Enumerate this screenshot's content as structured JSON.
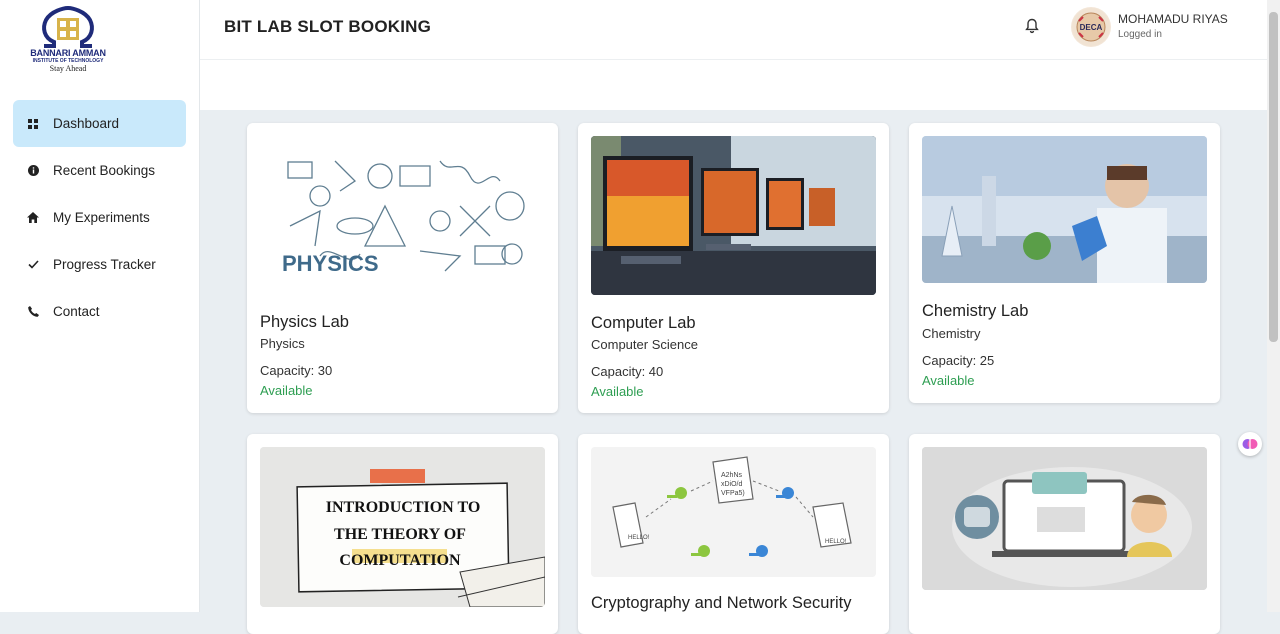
{
  "sidebar": {
    "logo": {
      "name": "BANNARI AMMAN",
      "subtitle": "INSTITUTE OF TECHNOLOGY",
      "tagline": "Stay Ahead"
    },
    "items": [
      {
        "label": "Dashboard",
        "icon": "grid-icon",
        "active": true
      },
      {
        "label": "Recent Bookings",
        "icon": "info-icon",
        "active": false
      },
      {
        "label": "My Experiments",
        "icon": "home-icon",
        "active": false
      },
      {
        "label": "Progress Tracker",
        "icon": "check-icon",
        "active": false
      },
      {
        "label": "Contact",
        "icon": "phone-icon",
        "active": false
      }
    ]
  },
  "header": {
    "title": "BIT LAB SLOT BOOKING",
    "user": {
      "name": "MOHAMADU RIYAS",
      "status": "Logged in",
      "avatar_text": "DECA"
    }
  },
  "labs": [
    {
      "title": "Physics Lab",
      "department": "Physics",
      "capacity": "Capacity: 30",
      "status": "Available",
      "image_text": "PHYSICS"
    },
    {
      "title": "Computer Lab",
      "department": "Computer Science",
      "capacity": "Capacity: 40",
      "status": "Available"
    },
    {
      "title": "Chemistry Lab",
      "department": "Chemistry",
      "capacity": "Capacity: 25",
      "status": "Available"
    },
    {
      "title": "",
      "image_text_lines": [
        "INTRODUCTION TO",
        "THE THEORY OF",
        "COMPUTATION"
      ]
    },
    {
      "title": "Cryptography and Network Security",
      "image_text": [
        "HELLO!",
        "A2hNs",
        "xDiO/d",
        "VFPa5)",
        "HELLO!"
      ]
    },
    {
      "title": ""
    }
  ],
  "colors": {
    "accent": "#c9e9fb",
    "available": "#2e9e52",
    "logo": "#1f2b7a"
  }
}
